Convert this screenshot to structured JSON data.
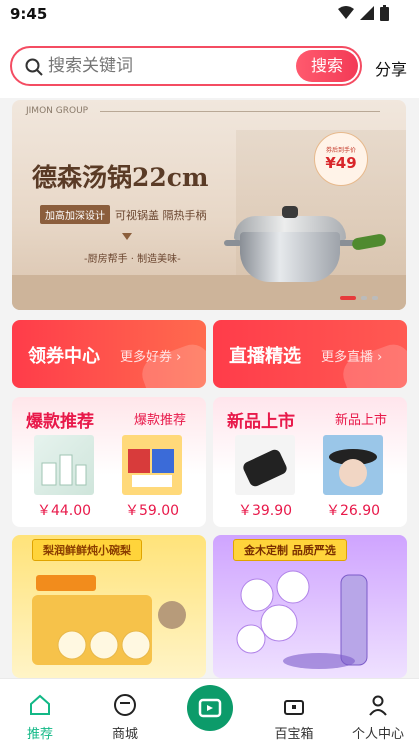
{
  "status_bar": {
    "time": "9:45"
  },
  "search": {
    "placeholder": "搜索关键词",
    "button_label": "搜索",
    "share_label": "分享"
  },
  "banner": {
    "brand": "JIMON GROUP",
    "title": "德森汤锅22cm",
    "tag_primary": "加高加深设计",
    "tag_secondary": "可视锅盖 隔热手柄",
    "slogan": "-厨房帮手 · 制造美味-",
    "price_label": "券后到手价",
    "price_value": "¥49",
    "carousel_pages": 3,
    "carousel_active": 1
  },
  "promos": [
    {
      "title": "领券中心",
      "subtitle": "更多好券"
    },
    {
      "title": "直播精选",
      "subtitle": "更多直播"
    }
  ],
  "cards": [
    {
      "title": "爆款推荐",
      "subtitle": "爆款推荐",
      "products": [
        {
          "price": "￥44.00"
        },
        {
          "price": "￥59.00"
        }
      ]
    },
    {
      "title": "新品上市",
      "subtitle": "新品上市",
      "products": [
        {
          "price": "￥39.90"
        },
        {
          "price": "￥26.90"
        }
      ]
    }
  ],
  "features": [
    {
      "head": "梨润鲜鲜炖小碗梨"
    },
    {
      "head": "金木定制 品质严选"
    }
  ],
  "tabbar": {
    "items": [
      {
        "label": "推荐"
      },
      {
        "label": "商城"
      },
      {
        "label": "百宝箱"
      },
      {
        "label": "个人中心"
      }
    ]
  },
  "colors": {
    "accent": "#f44c62",
    "brand_green": "#12b886",
    "price_red": "#e8194a"
  }
}
